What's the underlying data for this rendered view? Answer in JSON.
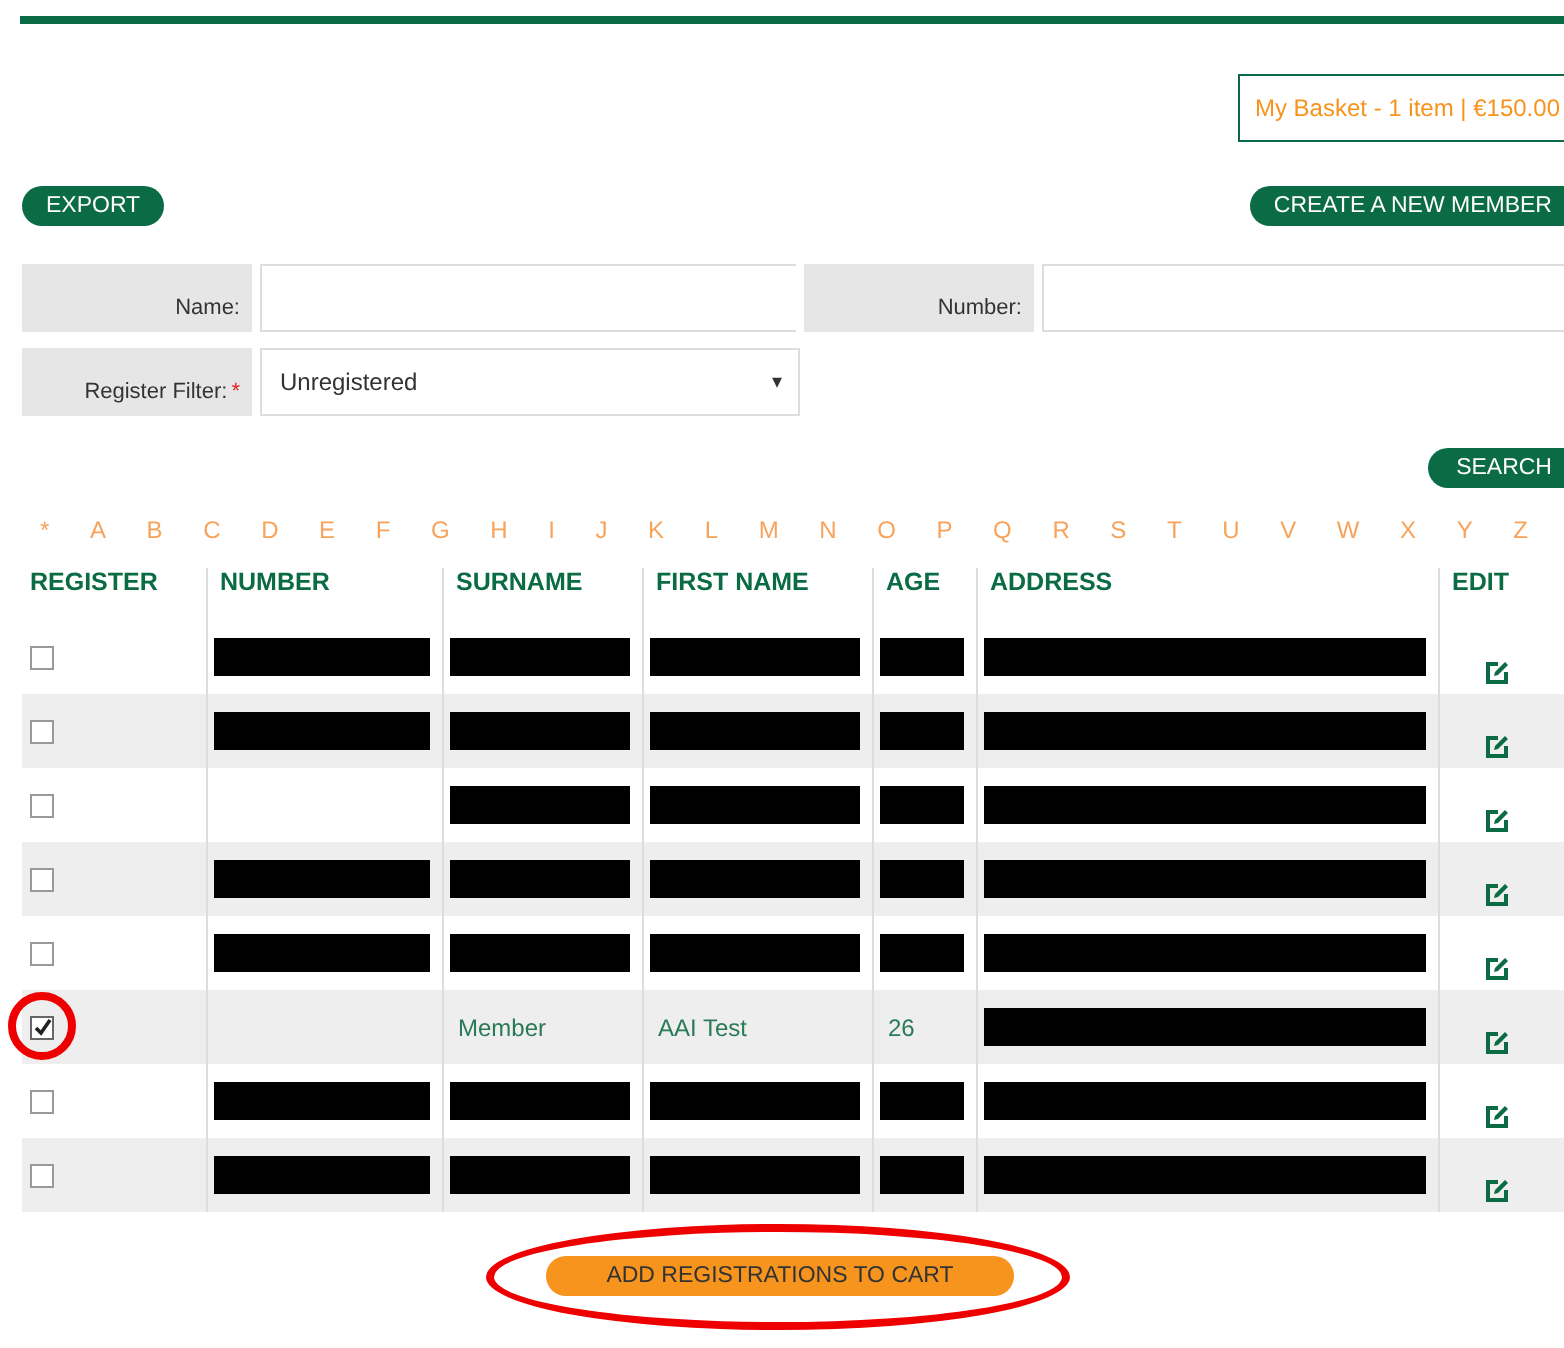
{
  "basket": "My Basket - 1 item | €150.00",
  "export_button": "EXPORT",
  "create_button": "CREATE A NEW MEMBER",
  "filters": {
    "name_label": "Name:",
    "number_label": "Number:",
    "register_label": "Register Filter:",
    "required_mark": "*",
    "register_value": "Unregistered",
    "dropdown_arrow": "▾"
  },
  "search_button": "SEARCH",
  "letters": [
    "*",
    "A",
    "B",
    "C",
    "D",
    "E",
    "F",
    "G",
    "H",
    "I",
    "J",
    "K",
    "L",
    "M",
    "N",
    "O",
    "P",
    "Q",
    "R",
    "S",
    "T",
    "U",
    "V",
    "W",
    "X",
    "Y",
    "Z"
  ],
  "table": {
    "columns": [
      "REGISTER",
      "NUMBER",
      "SURNAME",
      "FIRST NAME",
      "AGE",
      "ADDRESS",
      "EDIT"
    ],
    "rows": [
      {
        "checked": false,
        "circled": false,
        "cells": [
          {
            "kind": "checkbox"
          },
          {
            "kind": "redacted"
          },
          {
            "kind": "redacted"
          },
          {
            "kind": "redacted"
          },
          {
            "kind": "redacted"
          },
          {
            "kind": "redacted"
          },
          {
            "kind": "edit"
          }
        ]
      },
      {
        "checked": false,
        "circled": false,
        "cells": [
          {
            "kind": "checkbox"
          },
          {
            "kind": "redacted"
          },
          {
            "kind": "redacted"
          },
          {
            "kind": "redacted"
          },
          {
            "kind": "redacted"
          },
          {
            "kind": "redacted"
          },
          {
            "kind": "edit"
          }
        ]
      },
      {
        "checked": false,
        "circled": false,
        "cells": [
          {
            "kind": "checkbox"
          },
          {
            "kind": "empty"
          },
          {
            "kind": "redacted"
          },
          {
            "kind": "redacted"
          },
          {
            "kind": "redacted"
          },
          {
            "kind": "redacted"
          },
          {
            "kind": "edit"
          }
        ]
      },
      {
        "checked": false,
        "circled": false,
        "cells": [
          {
            "kind": "checkbox"
          },
          {
            "kind": "redacted"
          },
          {
            "kind": "redacted"
          },
          {
            "kind": "redacted"
          },
          {
            "kind": "redacted"
          },
          {
            "kind": "redacted"
          },
          {
            "kind": "edit"
          }
        ]
      },
      {
        "checked": false,
        "circled": false,
        "cells": [
          {
            "kind": "checkbox"
          },
          {
            "kind": "redacted"
          },
          {
            "kind": "redacted"
          },
          {
            "kind": "redacted"
          },
          {
            "kind": "redacted"
          },
          {
            "kind": "redacted"
          },
          {
            "kind": "edit"
          }
        ]
      },
      {
        "checked": true,
        "circled": true,
        "cells": [
          {
            "kind": "checkbox"
          },
          {
            "kind": "empty"
          },
          {
            "kind": "text",
            "text": "Member"
          },
          {
            "kind": "text",
            "text": "AAI Test"
          },
          {
            "kind": "text",
            "text": "26"
          },
          {
            "kind": "redacted"
          },
          {
            "kind": "edit"
          }
        ]
      },
      {
        "checked": false,
        "circled": false,
        "cells": [
          {
            "kind": "checkbox"
          },
          {
            "kind": "redacted"
          },
          {
            "kind": "redacted"
          },
          {
            "kind": "redacted"
          },
          {
            "kind": "redacted"
          },
          {
            "kind": "redacted"
          },
          {
            "kind": "edit"
          }
        ]
      },
      {
        "checked": false,
        "circled": false,
        "cells": [
          {
            "kind": "checkbox"
          },
          {
            "kind": "redacted"
          },
          {
            "kind": "redacted"
          },
          {
            "kind": "redacted"
          },
          {
            "kind": "redacted"
          },
          {
            "kind": "redacted"
          },
          {
            "kind": "edit"
          }
        ]
      }
    ]
  },
  "add_button": {
    "label": "ADD REGISTRATIONS TO CART",
    "circled": true
  }
}
